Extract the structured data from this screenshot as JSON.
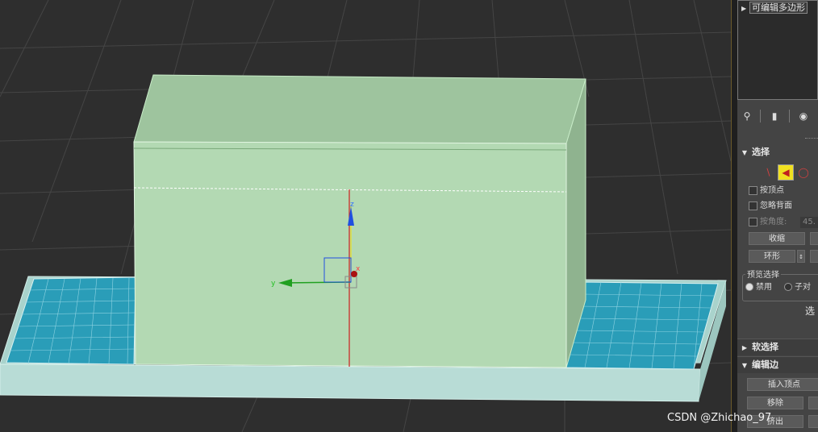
{
  "viewport": {
    "axis_z_label": "z",
    "axis_y_label": "y",
    "axis_x_label": "x",
    "colors": {
      "background": "#2e2e2e",
      "grid": "#4a4a4a",
      "box_front": "#b3d9b3",
      "box_top": "#9ec49e",
      "box_side": "#8fb38f",
      "base_slab": "#b8dcd6",
      "panel_mesh": "#2a9db8",
      "axis_x": "#cc2020",
      "axis_y": "#20a020",
      "axis_z": "#2050e0"
    }
  },
  "panel": {
    "modifier_stack": {
      "item_label": "可编辑多边形"
    },
    "toolbar_icons": [
      "pin-stack-icon",
      "show-end-result-icon",
      "configure-sets-icon"
    ],
    "selection_rollout": {
      "title": "选择",
      "by_vertex": "按顶点",
      "ignore_backfacing": "忽略背面",
      "by_angle": "按角度:",
      "angle_value": "45.",
      "shrink_button": "收缩",
      "ring_button": "环形",
      "preview_group_title": "预览选择",
      "preview_disabled": "禁用",
      "preview_subobject": "子对",
      "selected_text": "选"
    },
    "soft_selection_title": "软选择",
    "edit_edges": {
      "title": "编辑边",
      "insert_vertex_button": "插入顶点",
      "remove_button": "移除",
      "partial_text": "挤出"
    }
  },
  "watermark": "CSDN @Zhichao_97"
}
